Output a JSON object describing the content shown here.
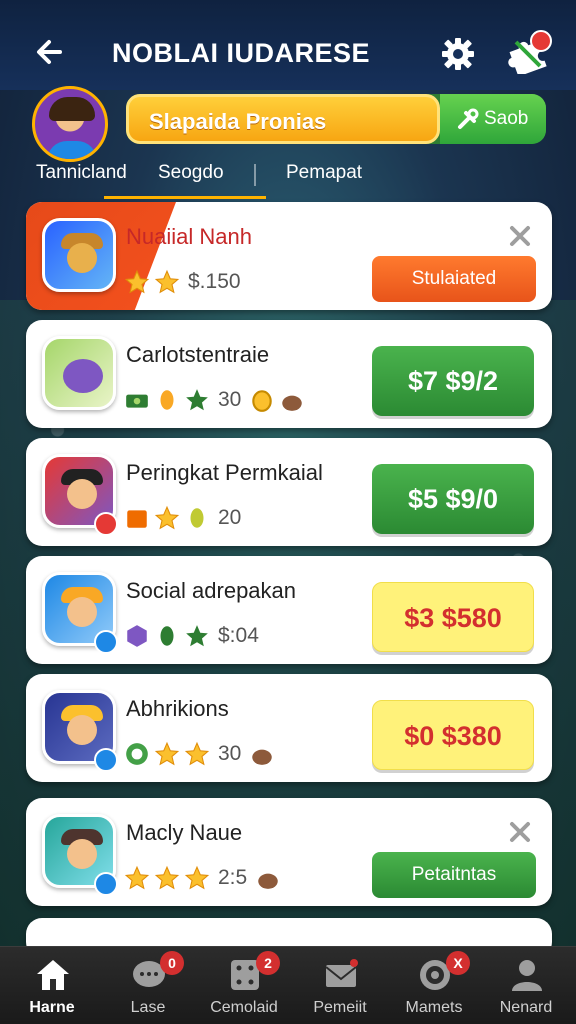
{
  "header": {
    "title": "NOBLAI IUDARESE",
    "back_icon": "arrow-left-icon",
    "settings_icon": "gear-icon",
    "puzzle_icon": "puzzle-icon"
  },
  "promo": {
    "label": "Slapaida Pronias",
    "button_label": "Saob"
  },
  "tabs": [
    {
      "label": "Tannicland"
    },
    {
      "label": "Seogdo"
    },
    {
      "label": "Pemapat"
    }
  ],
  "list": [
    {
      "title": "Nuaiial Nanh",
      "meta": [
        "$.150"
      ],
      "action": "Stulaiated",
      "featured": true
    },
    {
      "title": "Carlotstentraie",
      "meta": [
        "30"
      ],
      "price": "$7 $9/2",
      "style": "green"
    },
    {
      "title": "Peringkat Permkaial",
      "meta": [
        "20"
      ],
      "price": "$5 $9/0",
      "style": "green"
    },
    {
      "title": "Social adrepakan",
      "meta": [
        "$:04"
      ],
      "price": "$3 $580",
      "style": "yellow"
    },
    {
      "title": "Abhrikions",
      "meta": [
        "30"
      ],
      "price": "$0 $380",
      "style": "yellow"
    },
    {
      "title": "Macly Naue",
      "meta": [
        "2:5"
      ],
      "action": "Petaitntas"
    }
  ],
  "nav": [
    {
      "label": "Harne",
      "icon": "home-icon",
      "badge": ""
    },
    {
      "label": "Lase",
      "icon": "chat-icon",
      "badge": "0"
    },
    {
      "label": "Cemolaid",
      "icon": "dice-icon",
      "badge": "2"
    },
    {
      "label": "Pemeiit",
      "icon": "mail-icon",
      "badge": ""
    },
    {
      "label": "Mamets",
      "icon": "target-icon",
      "badge": "X"
    },
    {
      "label": "Nenard",
      "icon": "person-icon",
      "badge": ""
    }
  ],
  "colors": {
    "accent_orange": "#f4511e",
    "accent_green": "#2e7d32",
    "accent_yellow": "#ffcf3a",
    "badge_red": "#d32f2f"
  }
}
